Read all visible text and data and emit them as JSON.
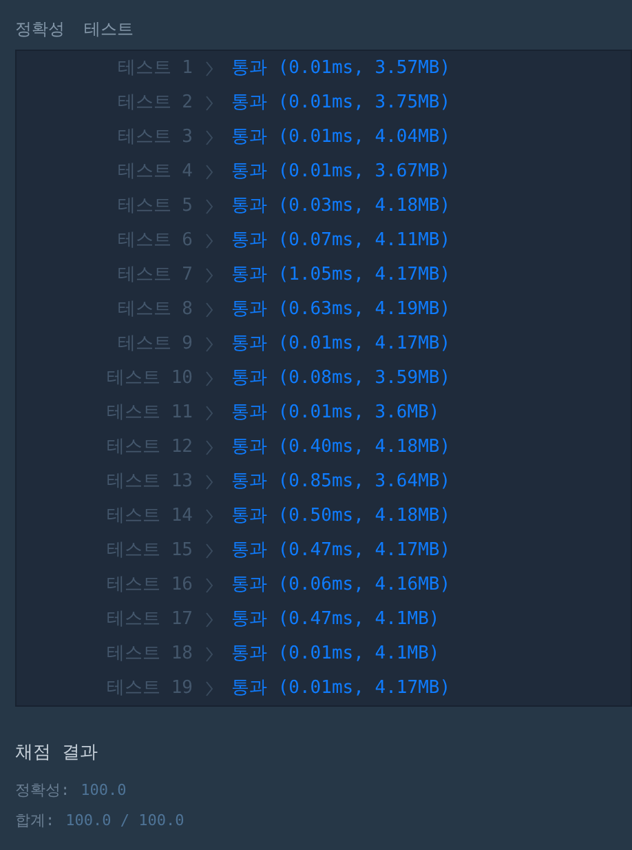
{
  "header": {
    "column_1": "정확성",
    "column_2": "테스트"
  },
  "tests": [
    {
      "label": "테스트 1",
      "status": "통과",
      "detail": "(0.01ms, 3.57MB)"
    },
    {
      "label": "테스트 2",
      "status": "통과",
      "detail": "(0.01ms, 3.75MB)"
    },
    {
      "label": "테스트 3",
      "status": "통과",
      "detail": "(0.01ms, 4.04MB)"
    },
    {
      "label": "테스트 4",
      "status": "통과",
      "detail": "(0.01ms, 3.67MB)"
    },
    {
      "label": "테스트 5",
      "status": "통과",
      "detail": "(0.03ms, 4.18MB)"
    },
    {
      "label": "테스트 6",
      "status": "통과",
      "detail": "(0.07ms, 4.11MB)"
    },
    {
      "label": "테스트 7",
      "status": "통과",
      "detail": "(1.05ms, 4.17MB)"
    },
    {
      "label": "테스트 8",
      "status": "통과",
      "detail": "(0.63ms, 4.19MB)"
    },
    {
      "label": "테스트 9",
      "status": "통과",
      "detail": "(0.01ms, 4.17MB)"
    },
    {
      "label": "테스트 10",
      "status": "통과",
      "detail": "(0.08ms, 3.59MB)"
    },
    {
      "label": "테스트 11",
      "status": "통과",
      "detail": "(0.01ms, 3.6MB)"
    },
    {
      "label": "테스트 12",
      "status": "통과",
      "detail": "(0.40ms, 4.18MB)"
    },
    {
      "label": "테스트 13",
      "status": "통과",
      "detail": "(0.85ms, 3.64MB)"
    },
    {
      "label": "테스트 14",
      "status": "통과",
      "detail": "(0.50ms, 4.18MB)"
    },
    {
      "label": "테스트 15",
      "status": "통과",
      "detail": "(0.47ms, 4.17MB)"
    },
    {
      "label": "테스트 16",
      "status": "통과",
      "detail": "(0.06ms, 4.16MB)"
    },
    {
      "label": "테스트 17",
      "status": "통과",
      "detail": "(0.47ms, 4.1MB)"
    },
    {
      "label": "테스트 18",
      "status": "통과",
      "detail": "(0.01ms, 4.1MB)"
    },
    {
      "label": "테스트 19",
      "status": "통과",
      "detail": "(0.01ms, 4.17MB)"
    }
  ],
  "summary": {
    "title": "채점 결과",
    "lines": [
      {
        "label": "정확성:",
        "value": "100.0"
      },
      {
        "label": "합계:",
        "value": "100.0 / 100.0"
      }
    ]
  }
}
